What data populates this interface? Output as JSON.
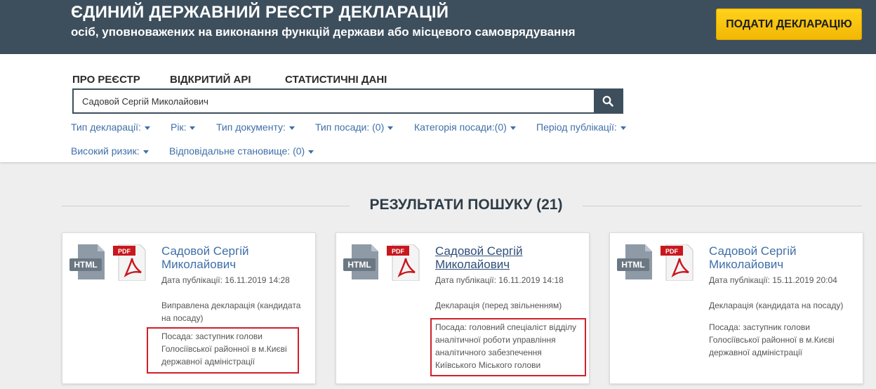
{
  "header": {
    "title": "ЄДИНИЙ ДЕРЖАВНИЙ РЕЄСТР ДЕКЛАРАЦІЙ",
    "subtitle": "осіб, уповноважених на виконання функцій держави або місцевого самоврядування",
    "submit_label": "ПОДАТИ ДЕКЛАРАЦІЮ"
  },
  "nav": {
    "items": [
      "ПРО РЕЄСТР",
      "ВІДКРИТИЙ API",
      "СТАТИСТИЧНІ ДАНІ"
    ]
  },
  "search": {
    "value": "Садовой Сергій Миколайович",
    "icon": "search-icon"
  },
  "filters": [
    "Тип декларації:",
    "Рік:",
    "Тип документу:",
    "Тип посади: (0)",
    "Категорія посади:(0)",
    "Період публікації:",
    "Високий ризик:",
    "Відповідальне становище: (0)"
  ],
  "results": {
    "heading": "РЕЗУЛЬТАТИ ПОШУКУ (21)"
  },
  "icons": {
    "html_label": "HTML",
    "pdf_label": "PDF"
  },
  "cards": [
    {
      "name": "Садовой Сергій Миколайович",
      "date": "Дата публікації: 16.11.2019 14:28",
      "type": "Виправлена декларація (кандидата на посаду)",
      "position": "Посада: заступник голови Голосіївської районної в м.Києві державної адміністрації"
    },
    {
      "name": "Садовой Сергій Миколайович",
      "date": "Дата публікації: 16.11.2019 14:18",
      "type": "Декларація (перед звільненням)",
      "position": "Посада: головний спеціаліст відділу аналітичної роботи управління аналітичного забезпечення Київського Міського голови"
    },
    {
      "name": "Садовой Сергій Миколайович",
      "date": "Дата публікації: 15.11.2019 20:04",
      "type": "Декларація (кандидата на посаду)",
      "position": "Посада: заступник голови Голосіївської районної в м.Києві державної адміністрації"
    }
  ],
  "colors": {
    "header_bg": "#3d4f5d",
    "accent_yellow": "#ffd21a",
    "link_blue": "#3f6fa8",
    "highlight_red": "#d0202a"
  }
}
